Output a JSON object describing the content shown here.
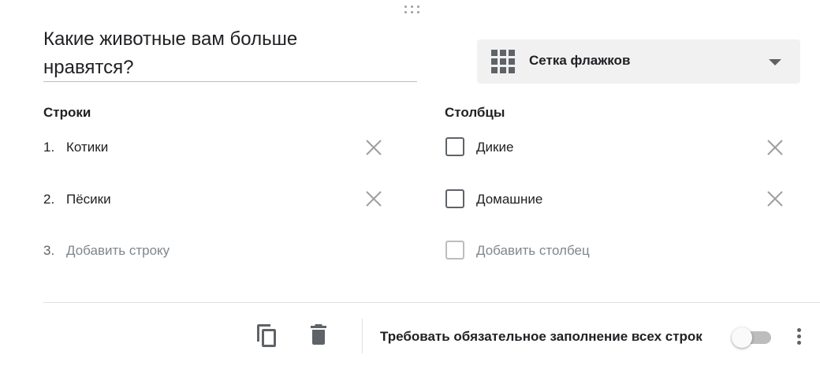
{
  "question": {
    "title_line1": "Какие животные вам больше",
    "title_line2": "нравятся?"
  },
  "type_select": {
    "icon": "grid-icon",
    "label": "Сетка флажков",
    "dropdown_icon": "chevron-down-icon"
  },
  "rows": {
    "heading": "Строки",
    "items": [
      {
        "number": "1.",
        "label": "Котики",
        "remove_icon": "close-icon"
      },
      {
        "number": "2.",
        "label": "Пёсики",
        "remove_icon": "close-icon"
      }
    ],
    "add": {
      "number": "3.",
      "placeholder": "Добавить строку"
    }
  },
  "columns": {
    "heading": "Столбцы",
    "items": [
      {
        "label": "Дикие",
        "remove_icon": "close-icon"
      },
      {
        "label": "Домашние",
        "remove_icon": "close-icon"
      }
    ],
    "add": {
      "placeholder": "Добавить столбец"
    }
  },
  "footer": {
    "duplicate_icon": "copy-icon",
    "delete_icon": "trash-icon",
    "required_label": "Требовать обязательное заполнение всех строк",
    "required_toggle_on": false,
    "more_icon": "more-vert-icon"
  },
  "colors": {
    "icon_gray": "#5f6368",
    "muted_gray": "#80868b",
    "select_bg": "#f1f1f1",
    "divider": "#e0e0e0"
  }
}
